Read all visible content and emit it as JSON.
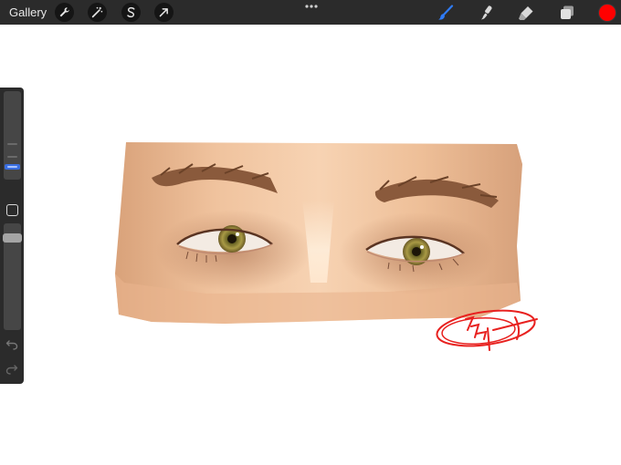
{
  "topbar": {
    "gallery_label": "Gallery",
    "left_tools": [
      "wrench-icon",
      "magic-wand-icon",
      "selection-s-icon",
      "transform-arrow-icon"
    ],
    "more_icon": "ellipsis-icon",
    "right_tools": [
      "brush-icon",
      "smudge-icon",
      "eraser-icon",
      "layers-icon"
    ],
    "active_tool": "brush-icon",
    "accent_color": "#2f7bf5",
    "current_color": "#ff0000"
  },
  "sidebar": {
    "brush_size_level": 0.18,
    "opacity_level": 0.9,
    "modifier_icon": "square-modifier-icon",
    "undo_icon": "undo-icon",
    "redo_icon": "redo-icon"
  },
  "canvas": {
    "artwork": "painted-eyes",
    "signature_color": "#e8211f"
  }
}
